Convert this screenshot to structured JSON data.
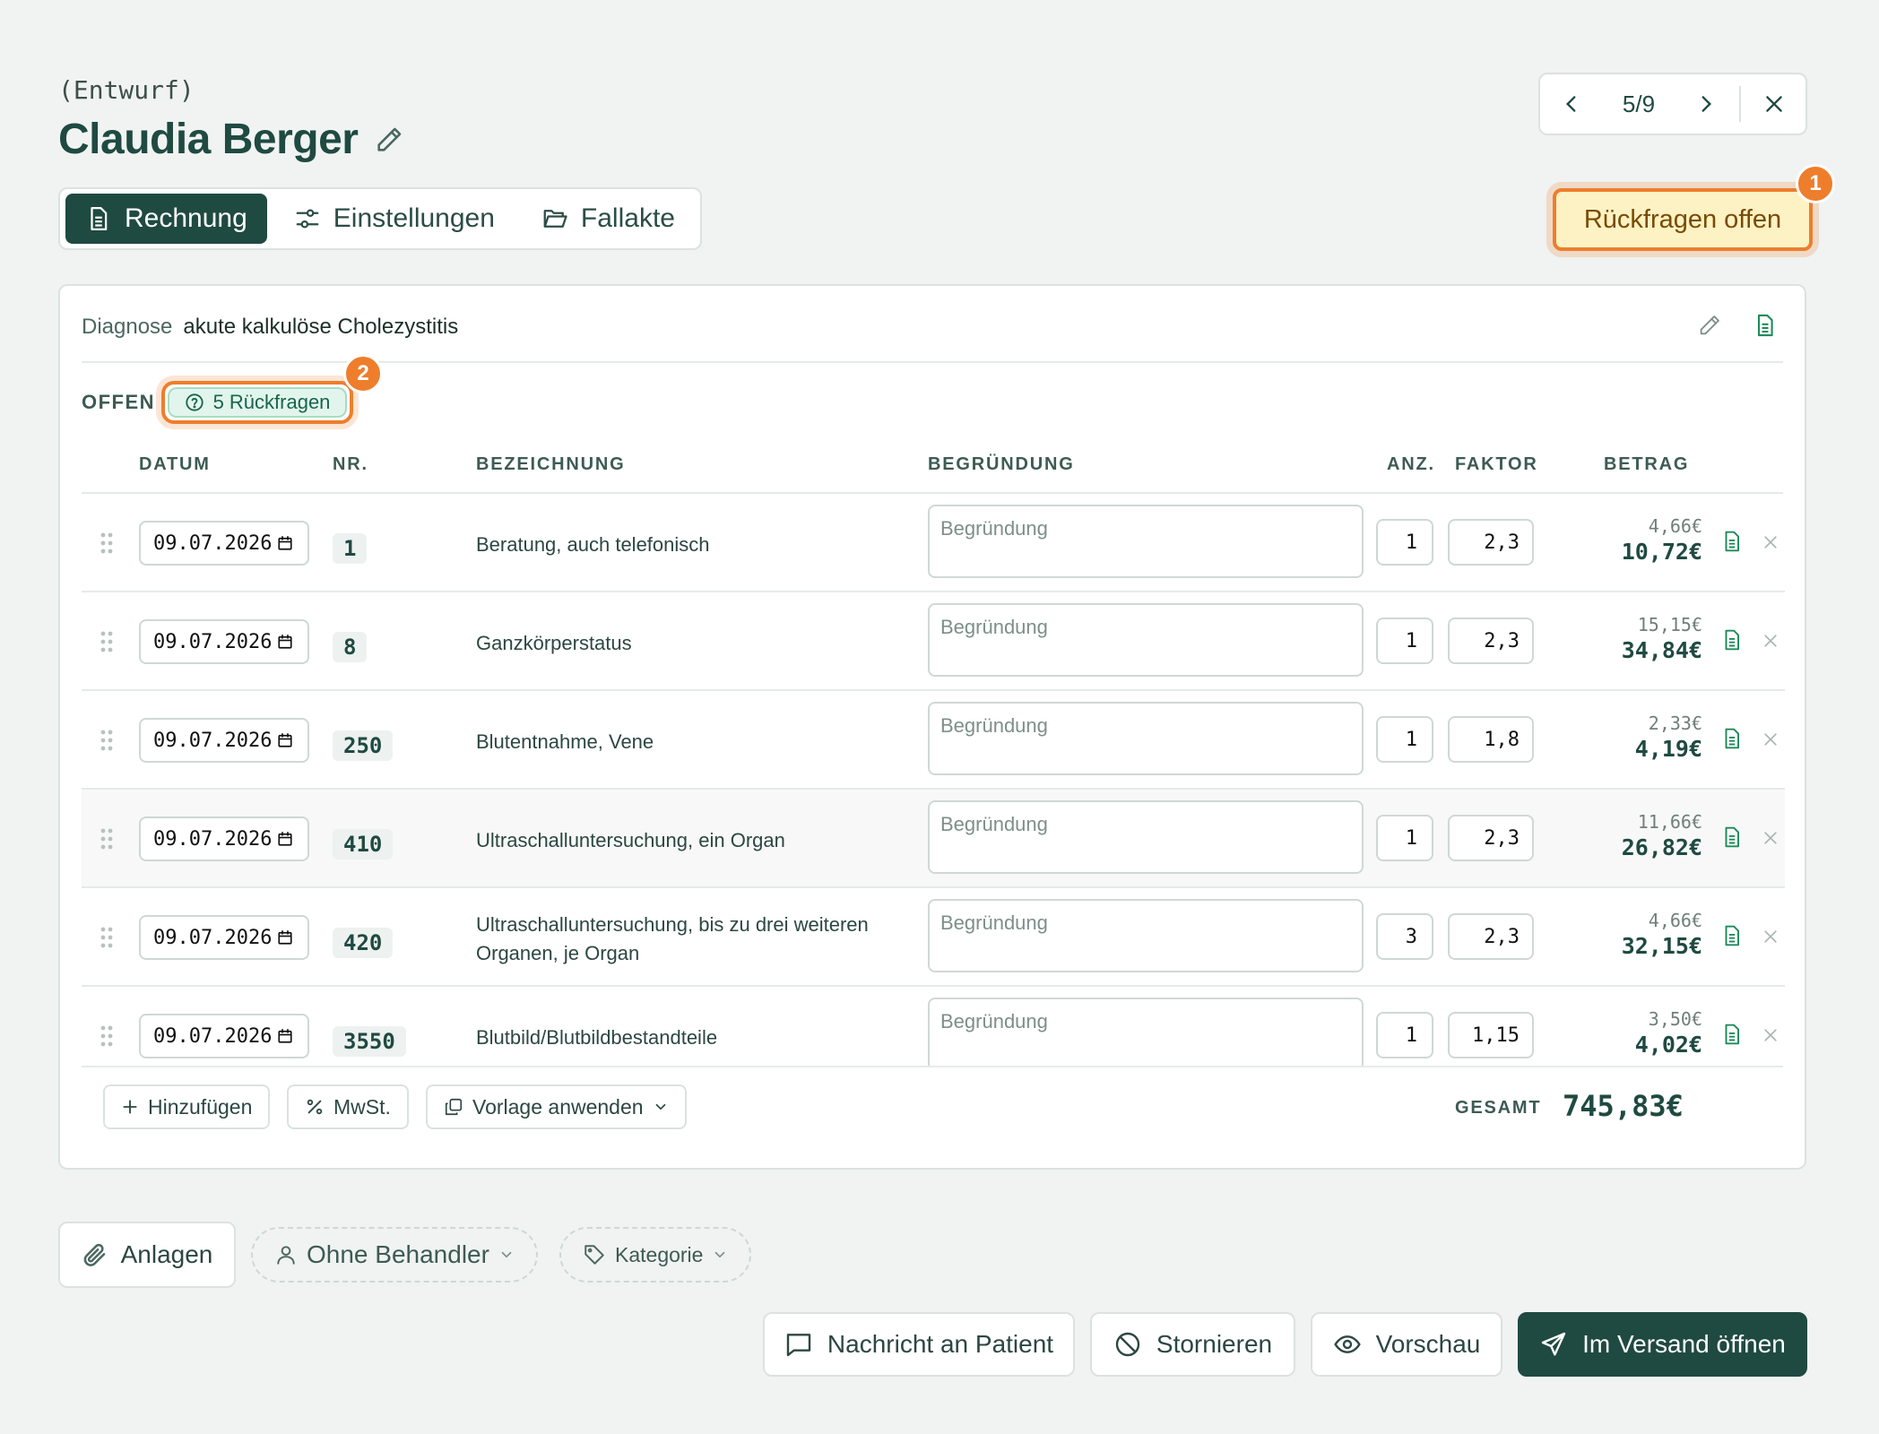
{
  "header": {
    "status": "(Entwurf)",
    "patient_name": "Claudia Berger",
    "pager": {
      "position": "5/9"
    }
  },
  "tabs": [
    {
      "label": "Rechnung",
      "active": true
    },
    {
      "label": "Einstellungen",
      "active": false
    },
    {
      "label": "Fallakte",
      "active": false
    }
  ],
  "rueckfragen_button": {
    "label": "Rückfragen offen",
    "badge": "1"
  },
  "diagnosis": {
    "label": "Diagnose",
    "value": "akute kalkulöse Cholezystitis"
  },
  "status": {
    "label": "OFFEN",
    "chip_label": "5 Rückfragen",
    "badge": "2"
  },
  "table": {
    "headers": {
      "datum": "DATUM",
      "nr": "NR.",
      "bezeichnung": "BEZEICHNUNG",
      "begruendung": "BEGRÜNDUNG",
      "anz": "ANZ.",
      "faktor": "FAKTOR",
      "betrag": "BETRAG"
    },
    "rows": [
      {
        "date": "09.07.2026",
        "nr": "1",
        "bezeichnung": "Beratung, auch telefonisch",
        "begruendung_placeholder": "Begründung",
        "anz": "1",
        "faktor": "2,3",
        "unit_price": "4,66€",
        "total": "10,72€"
      },
      {
        "date": "09.07.2026",
        "nr": "8",
        "bezeichnung": "Ganzkörperstatus",
        "begruendung_placeholder": "Begründung",
        "anz": "1",
        "faktor": "2,3",
        "unit_price": "15,15€",
        "total": "34,84€"
      },
      {
        "date": "09.07.2026",
        "nr": "250",
        "bezeichnung": "Blutentnahme, Vene",
        "begruendung_placeholder": "Begründung",
        "anz": "1",
        "faktor": "1,8",
        "unit_price": "2,33€",
        "total": "4,19€"
      },
      {
        "date": "09.07.2026",
        "nr": "410",
        "bezeichnung": "Ultraschalluntersuchung, ein Organ",
        "begruendung_placeholder": "Begründung",
        "anz": "1",
        "faktor": "2,3",
        "unit_price": "11,66€",
        "total": "26,82€"
      },
      {
        "date": "09.07.2026",
        "nr": "420",
        "bezeichnung": "Ultraschalluntersuchung, bis zu drei weiteren Organen, je Organ",
        "begruendung_placeholder": "Begründung",
        "anz": "3",
        "faktor": "2,3",
        "unit_price": "4,66€",
        "total": "32,15€"
      },
      {
        "date": "09.07.2026",
        "nr": "3550",
        "bezeichnung": "Blutbild/Blutbildbestandteile",
        "begruendung_placeholder": "Begründung",
        "anz": "1",
        "faktor": "1,15",
        "unit_price": "3,50€",
        "total": "4,02€"
      }
    ]
  },
  "footer": {
    "add_label": "Hinzufügen",
    "mwst_label": "MwSt.",
    "template_label": "Vorlage anwenden",
    "total_label": "GESAMT",
    "total_value": "745,83€"
  },
  "meta_bar": {
    "anlagen_label": "Anlagen",
    "behandler_label": "Ohne Behandler",
    "kategorie_label": "Kategorie"
  },
  "actions": {
    "message_label": "Nachricht an Patient",
    "cancel_label": "Stornieren",
    "preview_label": "Vorschau",
    "send_label": "Im Versand öffnen"
  },
  "colors": {
    "primary": "#1f4a41",
    "accent_orange": "#ee7e2c",
    "warning_bg": "#fdf2c4",
    "success_bg": "#e2f5ed",
    "doc_icon": "#1f8a5b"
  }
}
